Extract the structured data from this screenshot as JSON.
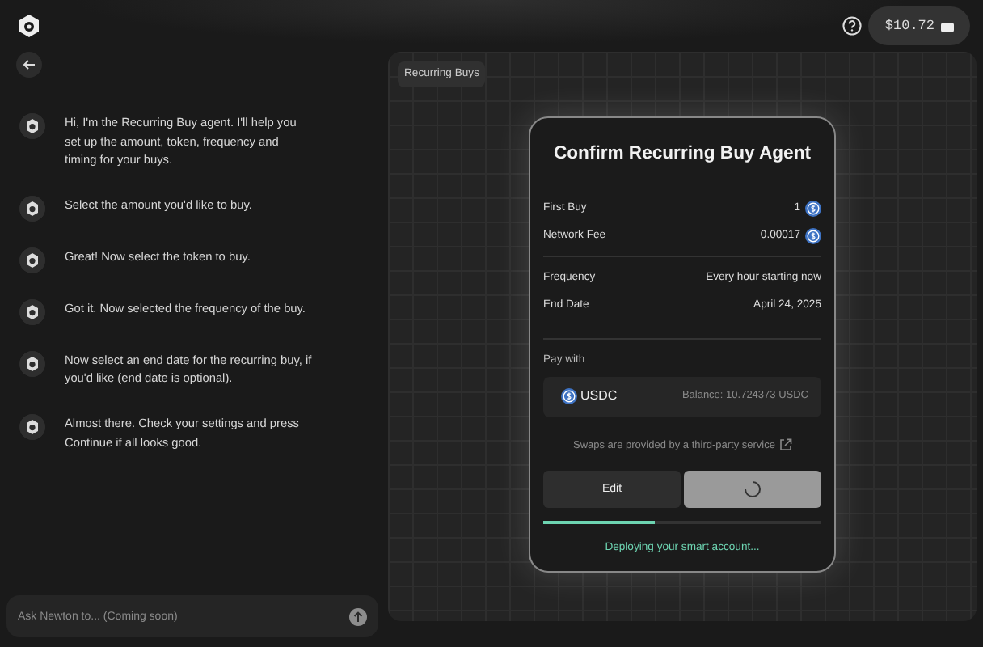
{
  "header": {
    "balance": "$10.72"
  },
  "messages": [
    {
      "text": "Hi, I'm the Recurring Buy agent. I'll help you set up the amount, token, frequency and timing for your buys."
    },
    {
      "text": "Select the amount you'd like to buy."
    },
    {
      "text": "Great! Now select the token to buy."
    },
    {
      "text": "Got it. Now selected the frequency of the buy."
    },
    {
      "text": "Now select an end date for the recurring buy, if you'd like (end date is optional)."
    },
    {
      "text": "Almost there. Check your settings and press Continue if all looks good."
    }
  ],
  "chat_input": {
    "placeholder": "Ask Newton to... (Coming soon)"
  },
  "canvas": {
    "tag": "Recurring Buys"
  },
  "card": {
    "title": "Confirm Recurring Buy Agent",
    "fees": [
      {
        "label": "First Buy",
        "value": "1"
      },
      {
        "label": "Network Fee",
        "value": "0.00017"
      }
    ],
    "details": [
      {
        "label": "Frequency",
        "value": "Every hour starting now"
      },
      {
        "label": "End Date",
        "value": "April 24, 2025"
      }
    ],
    "pay_with": {
      "label": "Pay with",
      "token": "USDC",
      "balance": "Balance: 10.724373 USDC"
    },
    "note": "Swaps are provided by a third-party service",
    "buttons": {
      "edit": "Edit",
      "confirm_loading": true
    },
    "progress": {
      "level": 0.4
    },
    "status": "Deploying your smart account..."
  }
}
